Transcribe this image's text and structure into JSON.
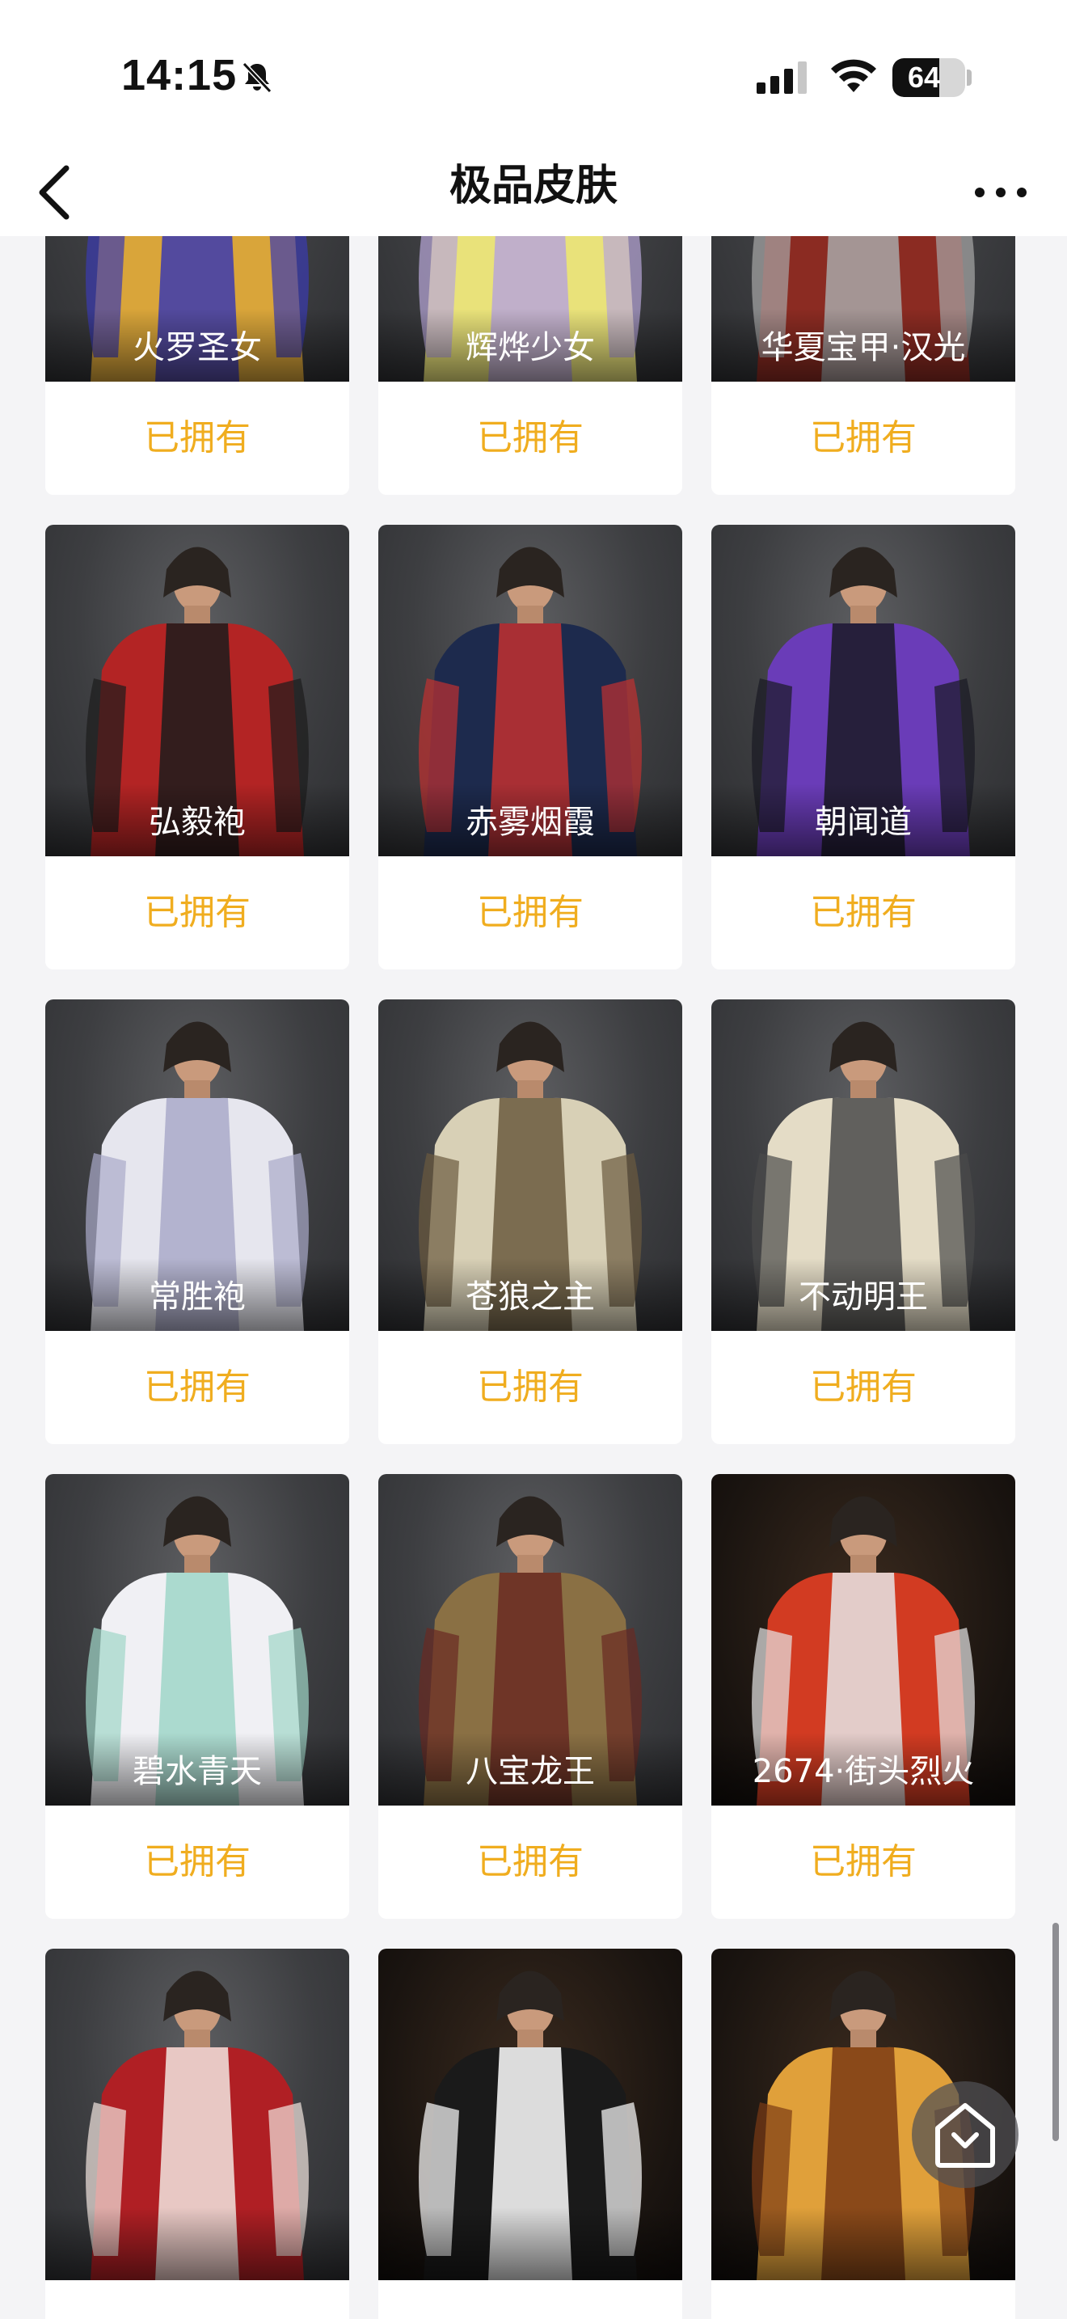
{
  "status_bar": {
    "time": "14:15",
    "battery_level": 64,
    "battery_label": "64",
    "icons": [
      "bell-slash-icon",
      "cellular-signal-icon",
      "wifi-icon",
      "battery-icon"
    ]
  },
  "nav": {
    "title": "极品皮肤",
    "back_icon": "chevron-left-icon",
    "more_icon": "more-dots-icon"
  },
  "skins": [
    {
      "name": "火罗圣女",
      "status": "已拥有"
    },
    {
      "name": "辉烨少女",
      "status": "已拥有"
    },
    {
      "name": "华夏宝甲·汉光",
      "status": "已拥有"
    },
    {
      "name": "弘毅袍",
      "status": "已拥有"
    },
    {
      "name": "赤雾烟霞",
      "status": "已拥有"
    },
    {
      "name": "朝闻道",
      "status": "已拥有"
    },
    {
      "name": "常胜袍",
      "status": "已拥有"
    },
    {
      "name": "苍狼之主",
      "status": "已拥有"
    },
    {
      "name": "不动明王",
      "status": "已拥有"
    },
    {
      "name": "碧水青天",
      "status": "已拥有"
    },
    {
      "name": "八宝龙王",
      "status": "已拥有"
    },
    {
      "name": "2674·街头烈火",
      "status": "已拥有"
    },
    {
      "name": "",
      "status": ""
    },
    {
      "name": "",
      "status": ""
    },
    {
      "name": "",
      "status": ""
    }
  ],
  "colors": {
    "owned_text": "#f0ad1f",
    "page_background": "#f4f4f6",
    "card_background": "#ffffff"
  },
  "floating_button": {
    "icon": "home-icon"
  }
}
